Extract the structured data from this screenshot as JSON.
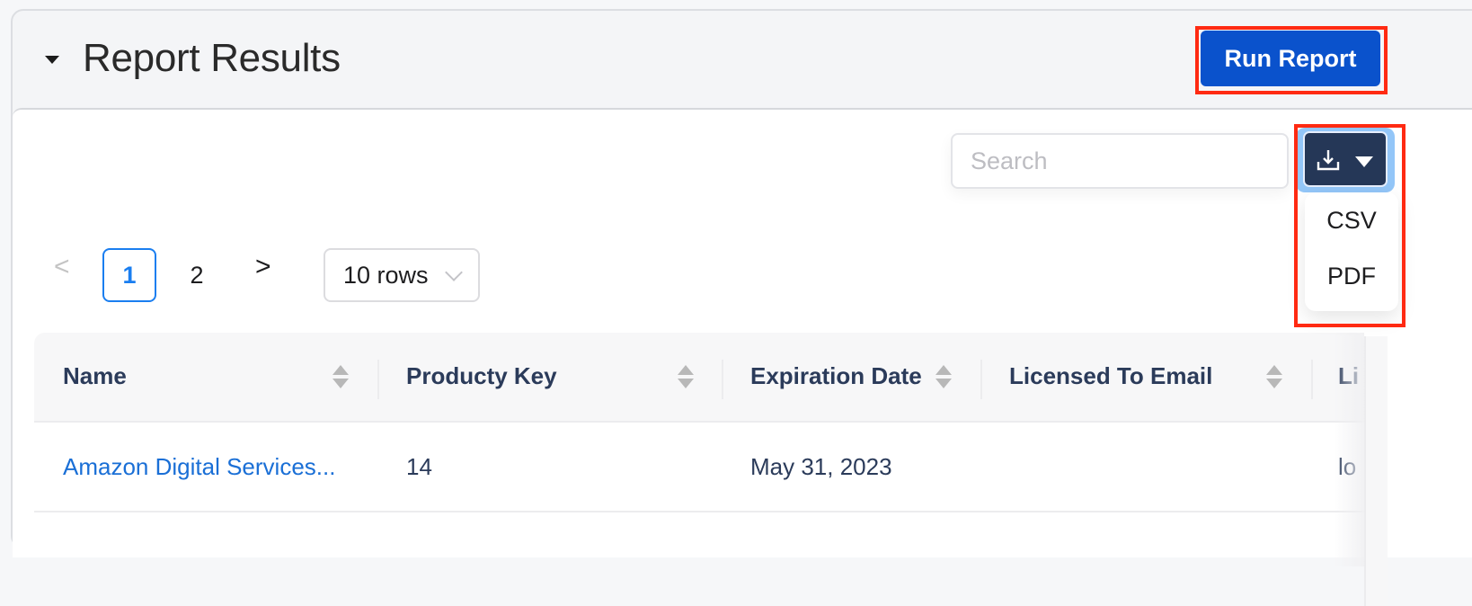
{
  "header": {
    "title": "Report Results",
    "run_button": "Run Report"
  },
  "toolbar": {
    "search_placeholder": "Search",
    "search_value": "",
    "download_icon": "download-icon",
    "download_menu": [
      "CSV",
      "PDF"
    ]
  },
  "pagination": {
    "prev": "<",
    "pages": [
      "1",
      "2"
    ],
    "current_page": "1",
    "next": ">",
    "rows_per_page": "10 rows"
  },
  "table": {
    "columns": [
      "Name",
      "Producty Key",
      "Expiration Date",
      "Licensed To Email",
      "Li"
    ],
    "rows": [
      [
        "Amazon Digital Services...",
        "14",
        "May 31, 2023",
        "",
        "lo"
      ]
    ]
  },
  "colors": {
    "primary": "#0a52cc",
    "download_button": "#253757",
    "link": "#1a6fd6",
    "active_page": "#1a7ef0",
    "highlight": "#ff2a12"
  }
}
